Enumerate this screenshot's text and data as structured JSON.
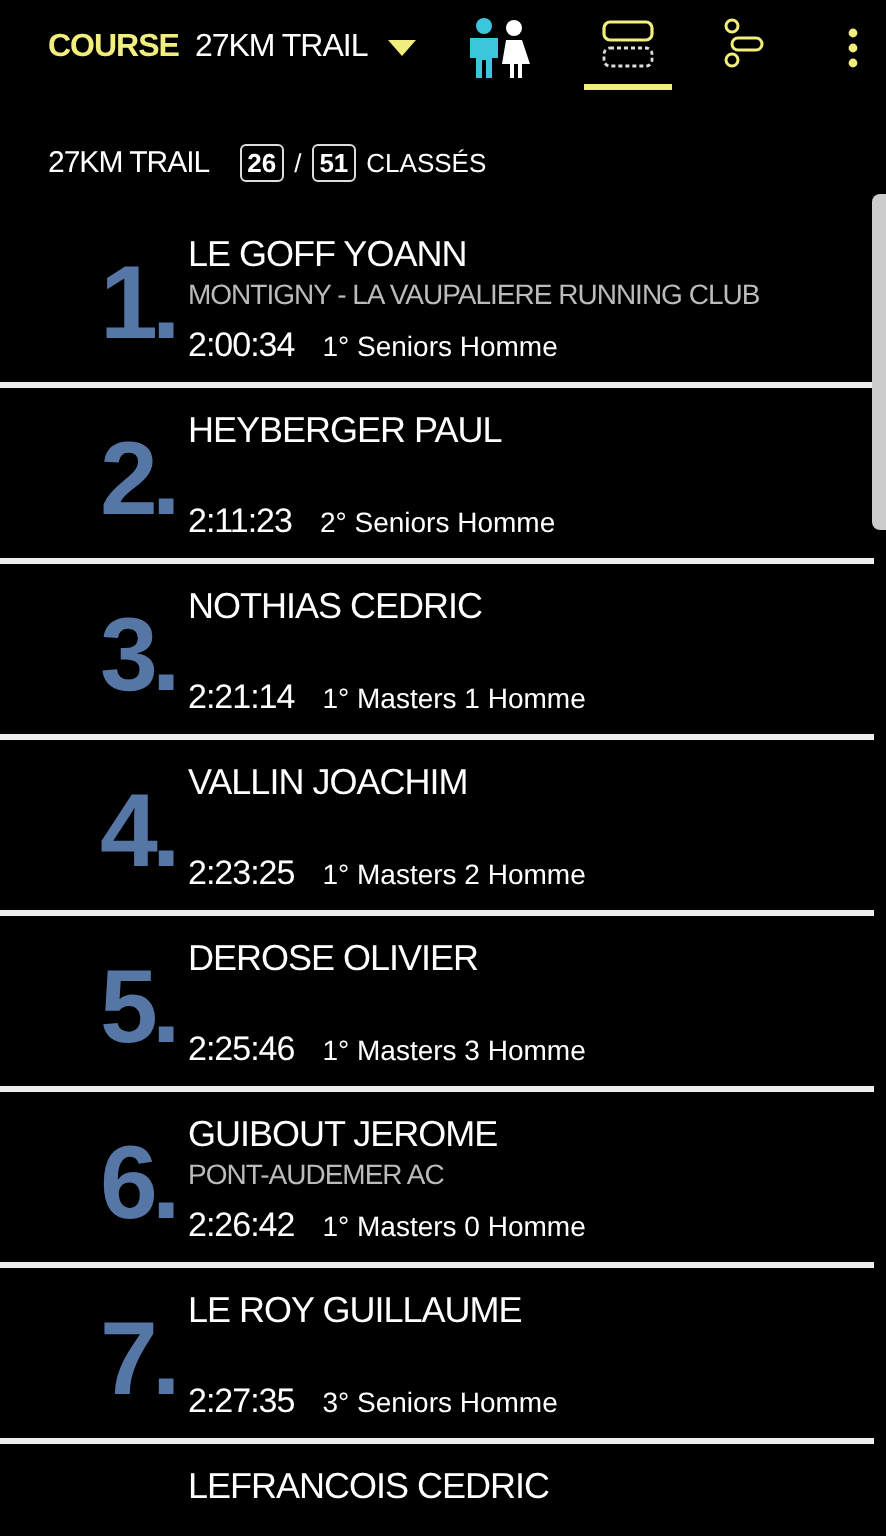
{
  "toolbar": {
    "label": "COURSE",
    "race": "27KM TRAIL",
    "view_tabs": [
      {
        "kind": "cards",
        "selected": true
      },
      {
        "kind": "tree",
        "selected": false
      }
    ]
  },
  "summary": {
    "race": "27KM TRAIL",
    "ranked": "26",
    "separator": "/",
    "total": "51",
    "suffix": "CLASSÉS"
  },
  "results": [
    {
      "rank": "1.",
      "name": "LE GOFF YOANN",
      "club": "MONTIGNY - LA VAUPALIERE RUNNING CLUB",
      "time": "2:00:34",
      "category": "1° Seniors Homme"
    },
    {
      "rank": "2.",
      "name": "HEYBERGER PAUL",
      "time": "2:11:23",
      "category": "2° Seniors Homme"
    },
    {
      "rank": "3.",
      "name": "NOTHIAS CEDRIC",
      "time": "2:21:14",
      "category": "1° Masters 1 Homme"
    },
    {
      "rank": "4.",
      "name": "VALLIN JOACHIM",
      "time": "2:23:25",
      "category": "1° Masters 2 Homme"
    },
    {
      "rank": "5.",
      "name": "DEROSE OLIVIER",
      "time": "2:25:46",
      "category": "1° Masters 3 Homme"
    },
    {
      "rank": "6.",
      "name": "GUIBOUT JEROME",
      "club": "PONT-AUDEMER AC",
      "time": "2:26:42",
      "category": "1° Masters 0 Homme"
    },
    {
      "rank": "7.",
      "name": "LE ROY GUILLAUME",
      "time": "2:27:35",
      "category": "3° Seniors Homme"
    },
    {
      "name": "LEFRANCOIS CEDRIC"
    }
  ]
}
